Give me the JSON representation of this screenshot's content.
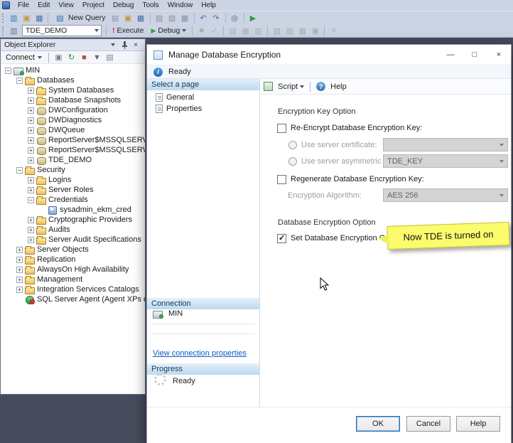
{
  "app": {
    "menu": [
      "File",
      "Edit",
      "View",
      "Project",
      "Debug",
      "Tools",
      "Window",
      "Help"
    ],
    "toolbar_main": {
      "icons_a": [
        {
          "name": "open-project-icon",
          "glyph": "▥",
          "color": "#3a7ab0"
        },
        {
          "name": "open-file-icon",
          "glyph": "▣",
          "color": "#c09a3a"
        },
        {
          "name": "save-icon",
          "glyph": "▦",
          "color": "#4a6fa8"
        }
      ],
      "new_query_glyph": "▤",
      "new_query_label": "New Query",
      "icons_b": [
        {
          "name": "new-item-icon",
          "glyph": "▤",
          "color": "#8a93a6"
        },
        {
          "name": "open-folder-icon",
          "glyph": "▣",
          "color": "#c09a3a"
        },
        {
          "name": "save-all-icon",
          "glyph": "▦",
          "color": "#4a6fa8"
        },
        {
          "name": "separator"
        },
        {
          "name": "cut-icon",
          "glyph": "▧",
          "color": "#8a93a6"
        },
        {
          "name": "copy-icon",
          "glyph": "▨",
          "color": "#8a93a6"
        },
        {
          "name": "paste-icon",
          "glyph": "▩",
          "color": "#8a93a6"
        },
        {
          "name": "separator"
        },
        {
          "name": "undo-icon",
          "glyph": "↶",
          "color": "#3a6fb5"
        },
        {
          "name": "redo-icon",
          "glyph": "↷",
          "color": "#3a6fb5"
        },
        {
          "name": "separator"
        },
        {
          "name": "find-icon",
          "glyph": "◎",
          "color": "#556070"
        },
        {
          "name": "separator"
        },
        {
          "name": "start-debug-icon",
          "glyph": "▶",
          "color": "#2e9e3e"
        }
      ]
    },
    "toolbar_query": {
      "icons_a": [
        {
          "name": "available-databases-icon",
          "glyph": "▥",
          "color": "#5a7aa0"
        }
      ],
      "db_value": "TDE_DEMO",
      "execute_bang": "!",
      "execute_label": "Execute",
      "debug_glyph": "▶",
      "debug_label": "Debug",
      "icons_b": [
        {
          "name": "separator"
        },
        {
          "name": "stop-icon",
          "glyph": "■",
          "color": "#a8b0bc"
        },
        {
          "name": "parse-icon",
          "glyph": "✓",
          "color": "#a8b0bc"
        },
        {
          "name": "separator"
        },
        {
          "name": "results-text-icon",
          "glyph": "▤",
          "color": "#a8b0bc"
        },
        {
          "name": "results-grid-icon",
          "glyph": "▦",
          "color": "#a8b0bc"
        },
        {
          "name": "results-file-icon",
          "glyph": "▥",
          "color": "#a8b0bc"
        },
        {
          "name": "separator"
        },
        {
          "name": "comment-icon",
          "glyph": "▧",
          "color": "#a8b0bc"
        },
        {
          "name": "uncomment-icon",
          "glyph": "▨",
          "color": "#a8b0bc"
        },
        {
          "name": "indent-icon",
          "glyph": "▩",
          "color": "#a8b0bc"
        },
        {
          "name": "outdent-icon",
          "glyph": "▣",
          "color": "#a8b0bc"
        },
        {
          "name": "separator"
        },
        {
          "name": "query-options-icon",
          "glyph": "≡",
          "color": "#a8b0bc"
        }
      ]
    }
  },
  "object_explorer": {
    "title": "Object Explorer",
    "header": {
      "close_glyph": "×"
    },
    "toolbar": {
      "connect_label": "Connect",
      "icons": [
        {
          "name": "disconnect-icon",
          "glyph": "▣",
          "color": "#7a8496"
        },
        {
          "name": "refresh-icon",
          "glyph": "↻",
          "color": "#2e8a3e"
        },
        {
          "name": "stop-icon",
          "glyph": "■",
          "color": "#b05050"
        },
        {
          "name": "filter-icon",
          "glyph": "▼",
          "color": "#5a6a80"
        },
        {
          "name": "report-icon",
          "glyph": "▤",
          "color": "#7a8496"
        }
      ]
    },
    "tree": [
      {
        "label": "MIN",
        "level": 0,
        "exp": "minus",
        "icon": "server"
      },
      {
        "label": "Databases",
        "level": 1,
        "exp": "minus",
        "icon": "folder"
      },
      {
        "label": "System Databases",
        "level": 2,
        "exp": "plus",
        "icon": "folder"
      },
      {
        "label": "Database Snapshots",
        "level": 2,
        "exp": "plus",
        "icon": "folder"
      },
      {
        "label": "DWConfiguration",
        "level": 2,
        "exp": "plus",
        "icon": "db"
      },
      {
        "label": "DWDiagnostics",
        "level": 2,
        "exp": "plus",
        "icon": "db"
      },
      {
        "label": "DWQueue",
        "level": 2,
        "exp": "plus",
        "icon": "db"
      },
      {
        "label": "ReportServer$MSSQLSERVER",
        "level": 2,
        "exp": "plus",
        "icon": "db"
      },
      {
        "label": "ReportServer$MSSQLSERVERTempDB",
        "level": 2,
        "exp": "plus",
        "icon": "db"
      },
      {
        "label": "TDE_DEMO",
        "level": 2,
        "exp": "plus",
        "icon": "db"
      },
      {
        "label": "Security",
        "level": 1,
        "exp": "minus",
        "icon": "folder"
      },
      {
        "label": "Logins",
        "level": 2,
        "exp": "plus",
        "icon": "folder"
      },
      {
        "label": "Server Roles",
        "level": 2,
        "exp": "plus",
        "icon": "folder"
      },
      {
        "label": "Credentials",
        "level": 2,
        "exp": "minus",
        "icon": "folder"
      },
      {
        "label": "sysadmin_ekm_cred",
        "level": 3,
        "exp": "none",
        "icon": "cred"
      },
      {
        "label": "Cryptographic Providers",
        "level": 2,
        "exp": "plus",
        "icon": "folder"
      },
      {
        "label": "Audits",
        "level": 2,
        "exp": "plus",
        "icon": "folder"
      },
      {
        "label": "Server Audit Specifications",
        "level": 2,
        "exp": "plus",
        "icon": "folder"
      },
      {
        "label": "Server Objects",
        "level": 1,
        "exp": "plus",
        "icon": "folder"
      },
      {
        "label": "Replication",
        "level": 1,
        "exp": "plus",
        "icon": "folder"
      },
      {
        "label": "AlwaysOn High Availability",
        "level": 1,
        "exp": "plus",
        "icon": "folder"
      },
      {
        "label": "Management",
        "level": 1,
        "exp": "plus",
        "icon": "folder"
      },
      {
        "label": "Integration Services Catalogs",
        "level": 1,
        "exp": "plus",
        "icon": "folder"
      },
      {
        "label": "SQL Server Agent (Agent XPs disabled)",
        "level": 1,
        "exp": "none",
        "icon": "agent"
      }
    ]
  },
  "dialog": {
    "title": "Manage Database Encryption",
    "window_controls": {
      "minimize": "—",
      "maximize": "□",
      "close": "×"
    },
    "status_ready": "Ready",
    "pages": {
      "header": "Select a page",
      "items": [
        {
          "label": "General"
        },
        {
          "label": "Properties"
        }
      ]
    },
    "toolbar": {
      "script_label": "Script",
      "help_label": "Help"
    },
    "content": {
      "group_key": "Encryption Key Option",
      "re_encrypt_label": "Re-Encrypt Database Encryption Key:",
      "cert_label": "Use server certificate:",
      "asym_label": "Use server asymmetric key:",
      "asym_value": "TDE_KEY",
      "regen_label": "Regenerate Database Encryption Key:",
      "algorithm_label": "Encryption Algorithm:",
      "algorithm_value": "AES 256",
      "group_db": "Database Encryption Option",
      "set_on_label": "Set Database Encryption On",
      "callout_text": "Now TDE is turned on"
    },
    "connection": {
      "header": "Connection",
      "server_name": "MIN",
      "link": "View connection properties"
    },
    "progress": {
      "header": "Progress",
      "status": "Ready"
    },
    "buttons": {
      "ok": "OK",
      "cancel": "Cancel",
      "help": "Help"
    }
  },
  "colors": {
    "callout_bg": "#fbfb6e",
    "section_header": "#bdd9ee",
    "link": "#0b5bc4"
  }
}
